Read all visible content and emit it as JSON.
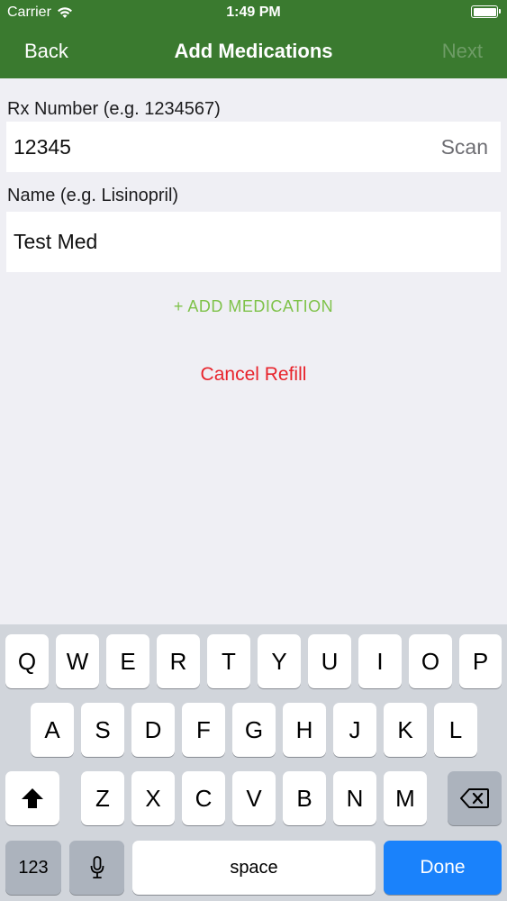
{
  "status_bar": {
    "carrier": "Carrier",
    "time": "1:49 PM"
  },
  "nav": {
    "back": "Back",
    "title": "Add Medications",
    "next": "Next"
  },
  "form": {
    "rx_label": "Rx Number (e.g. 1234567)",
    "rx_value": "12345",
    "scan": "Scan",
    "name_label": "Name (e.g. Lisinopril)",
    "name_value": "Test Med"
  },
  "actions": {
    "add_medication": "+ ADD  MEDICATION",
    "cancel_refill": "Cancel Refill"
  },
  "keyboard": {
    "row1": [
      "Q",
      "W",
      "E",
      "R",
      "T",
      "Y",
      "U",
      "I",
      "O",
      "P"
    ],
    "row2": [
      "A",
      "S",
      "D",
      "F",
      "G",
      "H",
      "J",
      "K",
      "L"
    ],
    "row3": [
      "Z",
      "X",
      "C",
      "V",
      "B",
      "N",
      "M"
    ],
    "numbers": "123",
    "space": "space",
    "done": "Done"
  },
  "colors": {
    "header": "#3a7a2f",
    "add": "#7fc24a",
    "cancel": "#e8232b",
    "done": "#1a82fb"
  }
}
